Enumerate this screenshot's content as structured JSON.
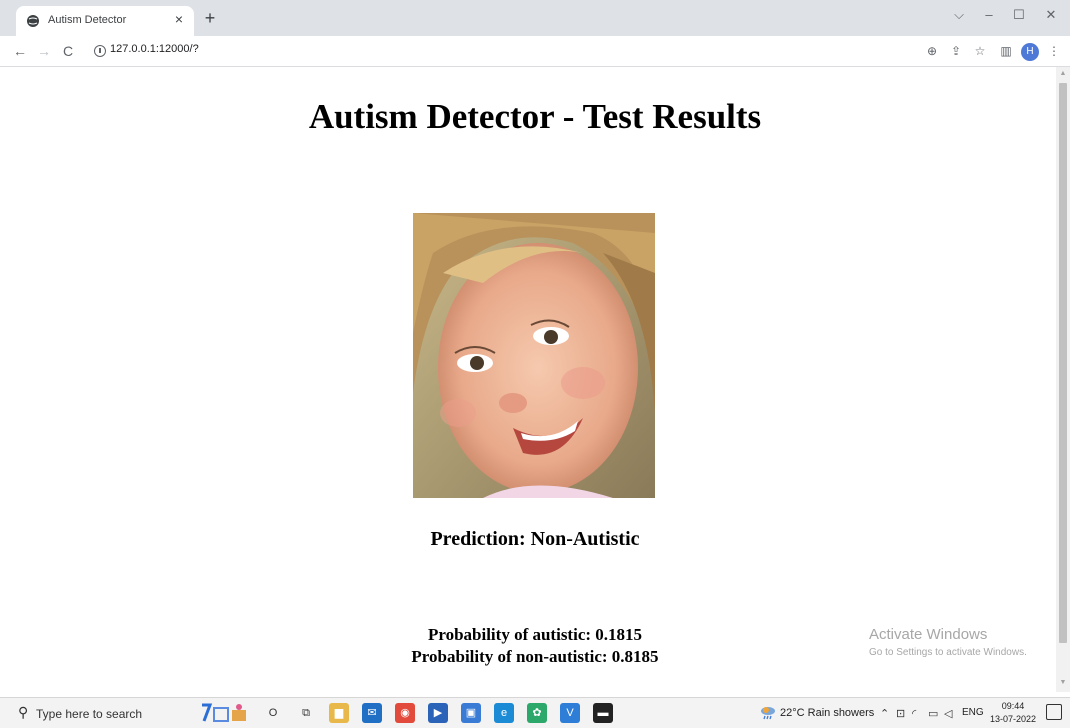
{
  "browser": {
    "tab_title": "Autism Detector",
    "tab_close": "×",
    "new_tab": "+",
    "url": "127.0.0.1:12000/?",
    "profile_initial": "H",
    "window_controls": {
      "collapse": "⌵",
      "minimize": "–",
      "maximize": "☐",
      "close": "✕"
    },
    "nav": {
      "back": "←",
      "forward": "→",
      "reload": "C"
    },
    "toolbar_icons": {
      "zoom": "⊕",
      "share": "⇪",
      "bookmark": "☆",
      "sidepanel": "▥",
      "menu": "⋮"
    }
  },
  "page": {
    "title": "Autism Detector - Test Results",
    "prediction": "Prediction: Non-Autistic",
    "probability_autistic": "Probability of autistic: 0.1815",
    "probability_non_autistic": "Probability of non-autistic: 0.8185"
  },
  "watermark": {
    "line1": "Activate Windows",
    "line2": "Go to Settings to activate Windows."
  },
  "taskbar": {
    "search_placeholder": "Type here to search",
    "weather": "22°C  Rain showers",
    "language": "ENG",
    "time": "09:44",
    "date": "13-07-2022",
    "apps": [
      {
        "name": "cortana",
        "glyph": "O",
        "color": "#333333"
      },
      {
        "name": "task-view",
        "glyph": "⧉",
        "color": "#333333"
      },
      {
        "name": "file-explorer",
        "glyph": "▆",
        "color": "#e8b84a"
      },
      {
        "name": "mail",
        "glyph": "✉",
        "color": "#1f6fc5"
      },
      {
        "name": "chrome",
        "glyph": "◉",
        "color": "#e24b3b"
      },
      {
        "name": "media",
        "glyph": "▶",
        "color": "#2a63b8"
      },
      {
        "name": "store",
        "glyph": "▣",
        "color": "#3a7bd5"
      },
      {
        "name": "edge",
        "glyph": "e",
        "color": "#1c8bd6"
      },
      {
        "name": "app-butterfly",
        "glyph": "✿",
        "color": "#2da86b"
      },
      {
        "name": "vscode",
        "glyph": "V",
        "color": "#2e7dd7"
      },
      {
        "name": "terminal",
        "glyph": "▬",
        "color": "#222222"
      }
    ]
  }
}
